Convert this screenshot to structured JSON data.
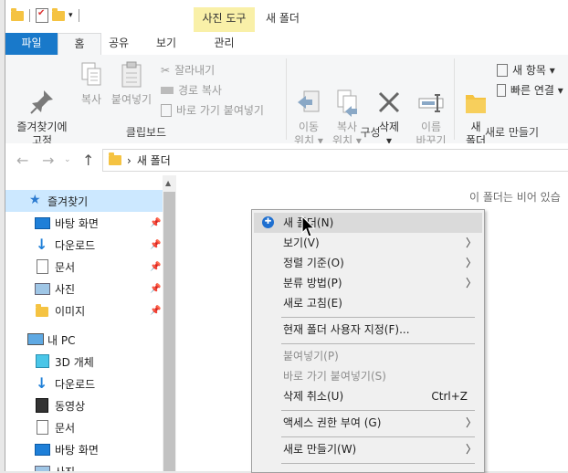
{
  "window": {
    "title": "새 폴더",
    "contextual_tab_group": "사진 도구"
  },
  "ribbon_tabs": [
    "파일",
    "홈",
    "공유",
    "보기",
    "관리"
  ],
  "clipboard": {
    "pin": "즐겨찾기에\n고정",
    "copy": "복사",
    "paste": "붙여넣기",
    "cut": "잘라내기",
    "copy_path": "경로 복사",
    "paste_shortcut": "바로 가기 붙여넣기",
    "group_label": "클립보드"
  },
  "organize": {
    "move_to": "이동\n위치 ▾",
    "copy_to": "복사\n위치 ▾",
    "delete": "삭제\n▾",
    "rename": "이름\n바꾸기",
    "group_label": "구성"
  },
  "new": {
    "new_folder": "새\n폴더",
    "new_item": "새 항목 ▾",
    "easy_access": "빠른 연결 ▾",
    "group_label": "새로 만들기"
  },
  "address": {
    "path_separator": "›",
    "path": "새 폴더"
  },
  "nav_pane": {
    "quick_access": "즐겨찾기",
    "quick_items": [
      "바탕 화면",
      "다운로드",
      "문서",
      "사진",
      "이미지"
    ],
    "this_pc": "내 PC",
    "pc_items": [
      "3D 개체",
      "다운로드",
      "동영상",
      "문서",
      "바탕 화면",
      "사진"
    ]
  },
  "content": {
    "empty_message": "이 폴더는 비어 있습"
  },
  "context_menu": {
    "new_folder": "새 폴더(N)",
    "view": "보기(V)",
    "sort_by": "정렬 기준(O)",
    "group_by": "분류 방법(P)",
    "refresh": "새로 고침(E)",
    "customize": "현재 폴더 사용자 지정(F)...",
    "paste": "붙여넣기(P)",
    "paste_shortcut": "바로 가기 붙여넣기(S)",
    "undo_delete": "삭제 취소(U)",
    "undo_shortcut": "Ctrl+Z",
    "give_access": "액세스 권한 부여 (G)",
    "new": "새로 만들기(W)"
  },
  "colors": {
    "file_tab": "#1979ca",
    "selection": "#cce8ff",
    "contextual_tab": "#f9f0a8",
    "menu_highlight": "#dadada",
    "folder": "#f5c342"
  }
}
